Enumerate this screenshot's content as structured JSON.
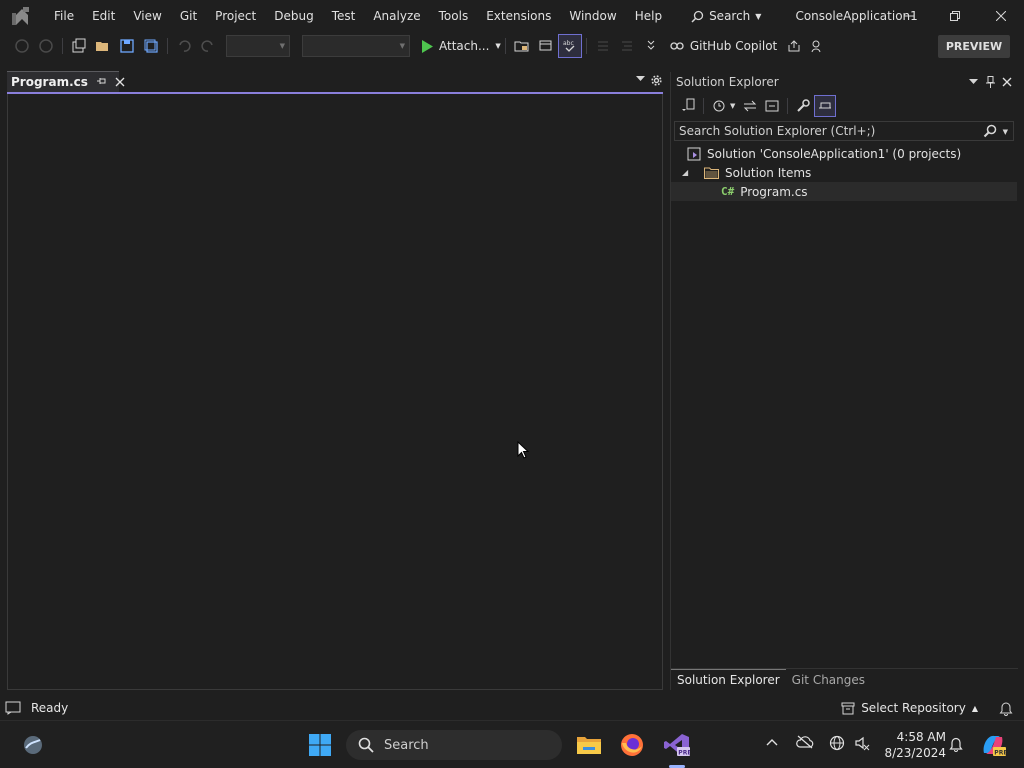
{
  "menu": {
    "items": [
      "File",
      "Edit",
      "View",
      "Git",
      "Project",
      "Debug",
      "Test",
      "Analyze",
      "Tools",
      "Extensions",
      "Window",
      "Help"
    ],
    "search_label": "Search",
    "app_title": "ConsoleApplication1"
  },
  "toolbar": {
    "attach_label": "Attach...",
    "copilot_label": "GitHub Copilot",
    "preview_label": "PREVIEW"
  },
  "editor": {
    "tab_label": "Program.cs"
  },
  "solution_explorer": {
    "title": "Solution Explorer",
    "search_placeholder": "Search Solution Explorer (Ctrl+;)",
    "tree": {
      "solution_label": "Solution 'ConsoleApplication1' (0 projects)",
      "folder_label": "Solution Items",
      "file_label": "Program.cs",
      "file_badge": "C#"
    },
    "bottom_tabs": [
      "Solution Explorer",
      "Git Changes"
    ]
  },
  "status": {
    "ready": "Ready",
    "repo": "Select Repository"
  },
  "taskbar": {
    "search_placeholder": "Search",
    "time": "4:58 AM",
    "date": "8/23/2024"
  },
  "colors": {
    "background": "#1f1f1f",
    "tab_accent": "#8a7fdb",
    "play_green": "#4ec54e",
    "csharp_green": "#8ccf6d",
    "folder_yellow": "#dcb67a",
    "vs_purple": "#8a63d2"
  },
  "icons": [
    "vs-logo-icon",
    "search-icon",
    "minimize-icon",
    "restore-icon",
    "close-icon",
    "play-icon",
    "pin-icon",
    "gear-icon",
    "folder-icon",
    "solution-icon",
    "bell-icon",
    "windows-start-icon",
    "file-explorer-icon",
    "firefox-icon",
    "visual-studio-icon",
    "copilot-icon"
  ]
}
